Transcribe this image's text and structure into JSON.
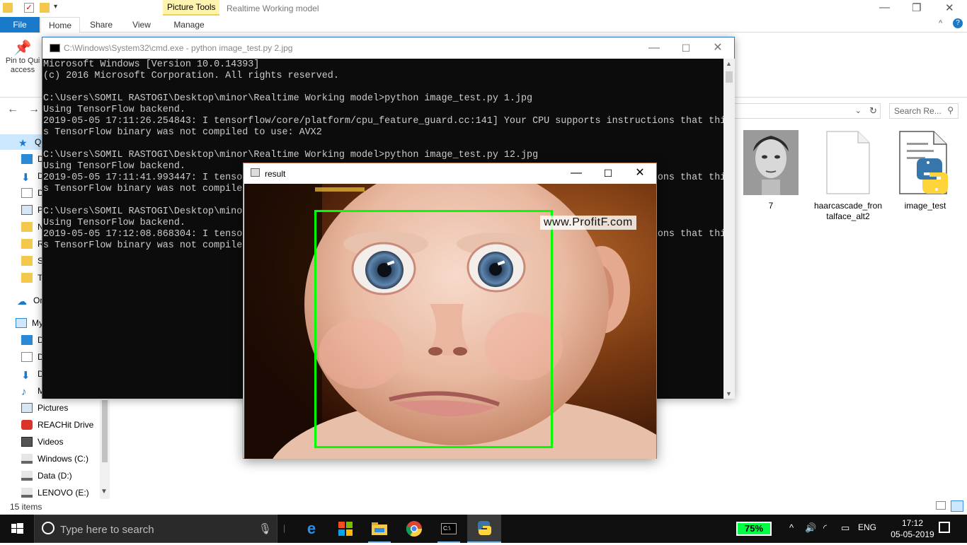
{
  "explorer": {
    "context_tab": "Picture Tools",
    "window_title": "Realtime Working model",
    "tabs": {
      "file": "File",
      "home": "Home",
      "share": "Share",
      "view": "View",
      "manage": "Manage"
    },
    "ribbon": {
      "pin_label_1": "Pin to Qui",
      "pin_label_2": "access"
    },
    "search_placeholder": "Search Re...",
    "sidebar_partial": [
      "Qu",
      "D",
      "D",
      "D",
      "P",
      "N",
      "R",
      "S",
      "T",
      "On",
      "My",
      "D",
      "D",
      "D",
      "M"
    ],
    "sidebar_full": [
      "Pictures",
      "REACHit Drive",
      "Videos",
      "Windows (C:)",
      "Data (D:)",
      "LENOVO (E:)"
    ],
    "status": "15 items",
    "files": [
      {
        "name": "7"
      },
      {
        "name": "haarcascade_fron talface_alt2"
      },
      {
        "name": "image_test"
      }
    ]
  },
  "cmd": {
    "title": "C:\\Windows\\System32\\cmd.exe - python  image_test.py 2.jpg",
    "lines": [
      "Microsoft Windows [Version 10.0.14393]",
      "(c) 2016 Microsoft Corporation. All rights reserved.",
      "",
      "C:\\Users\\SOMIL RASTOGI\\Desktop\\minor\\Realtime Working model>python image_test.py 1.jpg",
      "Using TensorFlow backend.",
      "2019-05-05 17:11:26.254843: I tensorflow/core/platform/cpu_feature_guard.cc:141] Your CPU supports instructions that thi",
      "s TensorFlow binary was not compiled to use: AVX2",
      "",
      "C:\\Users\\SOMIL RASTOGI\\Desktop\\minor\\Realtime Working model>python image_test.py 12.jpg",
      "Using TensorFlow backend.",
      "2019-05-05 17:11:41.993447: I tensorflow/core/platform/cpu_feature_guard.cc:141] Your CPU supports instructions that thi",
      "s TensorFlow binary was not compiled to use: AVX2",
      "",
      "C:\\Users\\SOMIL RASTOGI\\Desktop\\minor\\Realtime Working model>python image_test.py 2.jpg",
      "Using TensorFlow backend.",
      "2019-05-05 17:12:08.868304: I tensorflow/core/platform/cpu_feature_guard.cc:141] Your CPU supports instructions that thi",
      "s TensorFlow binary was not compiled to use: AVX2"
    ]
  },
  "result": {
    "title": "result",
    "watermark": "www.ProfitF.com"
  },
  "taskbar": {
    "search_placeholder": "Type here to search",
    "battery": "75%",
    "language": "ENG",
    "time": "17:12",
    "date": "05-05-2019"
  },
  "colors": {
    "accent": "#1979ca",
    "face_box": "#00ff00",
    "battery": "#00ff44",
    "taskbar": "#101010"
  }
}
